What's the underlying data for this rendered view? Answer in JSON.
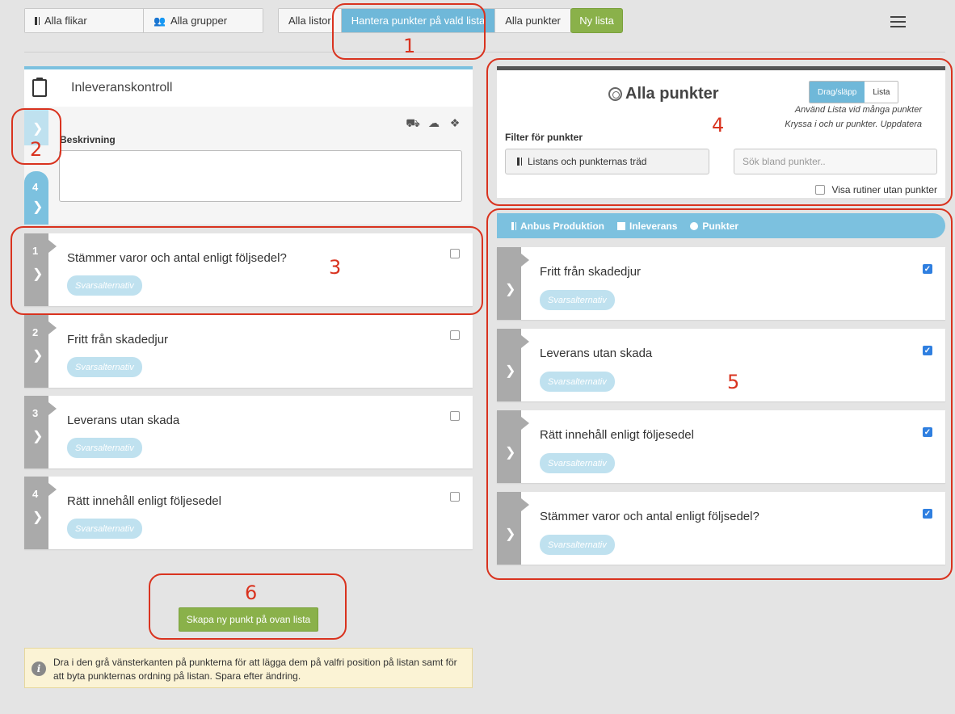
{
  "toolbar": {
    "all_tabs": "Alla flikar",
    "all_groups": "Alla grupper",
    "all_lists": "Alla listor",
    "manage_points": "Hantera punkter på vald lista",
    "all_points": "Alla punkter",
    "new_list": "Ny lista",
    "menu_icon": "hamburger-icon"
  },
  "annotations": [
    "1",
    "2",
    "3",
    "4",
    "5",
    "6"
  ],
  "list": {
    "title": "Inleveranskontroll",
    "description_label": "Beskrivning",
    "description_value": "",
    "side_tab_number": "4",
    "items": [
      {
        "number": "1",
        "text": "Stämmer varor och antal enligt följsedel?",
        "answer_label": "Svarsalternativ",
        "checked": false
      },
      {
        "number": "2",
        "text": "Fritt från skadedjur",
        "answer_label": "Svarsalternativ",
        "checked": false
      },
      {
        "number": "3",
        "text": "Leverans utan skada",
        "answer_label": "Svarsalternativ",
        "checked": false
      },
      {
        "number": "4",
        "text": "Rätt innehåll enligt följesedel",
        "answer_label": "Svarsalternativ",
        "checked": false
      }
    ],
    "create_button": "Skapa ny punkt på ovan lista",
    "info_text": "Dra i den grå vänsterkanten på punkterna för att lägga dem på valfri position på listan samt för att byta punkternas ordning på listan. Spara efter ändring."
  },
  "points_panel": {
    "title": "Alla punkter",
    "toggle": {
      "drag": "Drag/släpp",
      "list": "Lista",
      "selected": "Drag/släpp"
    },
    "hint_line1": "Använd Lista vid många punkter",
    "hint_line2": "Kryssa i och ur punkter. Uppdatera",
    "filter_label": "Filter för punkter",
    "tree_button": "Listans och punkternas träd",
    "search_placeholder": "Sök bland punkter..",
    "show_routines_label": "Visa rutiner utan punkter",
    "breadcrumb": [
      "Anbus Produktion",
      "Inleverans",
      "Punkter"
    ],
    "items": [
      {
        "text": "Fritt från skadedjur",
        "answer_label": "Svarsalternativ",
        "checked": true
      },
      {
        "text": "Leverans utan skada",
        "answer_label": "Svarsalternativ",
        "checked": true
      },
      {
        "text": "Rätt innehåll enligt följesedel",
        "answer_label": "Svarsalternativ",
        "checked": true
      },
      {
        "text": "Stämmer varor och antal enligt följsedel?",
        "answer_label": "Svarsalternativ",
        "checked": true
      }
    ]
  },
  "colors": {
    "accent_blue": "#6fb8d9",
    "green": "#8ab14a",
    "annotation_red": "#d9331f",
    "grip_gray": "#aaaaaa"
  }
}
